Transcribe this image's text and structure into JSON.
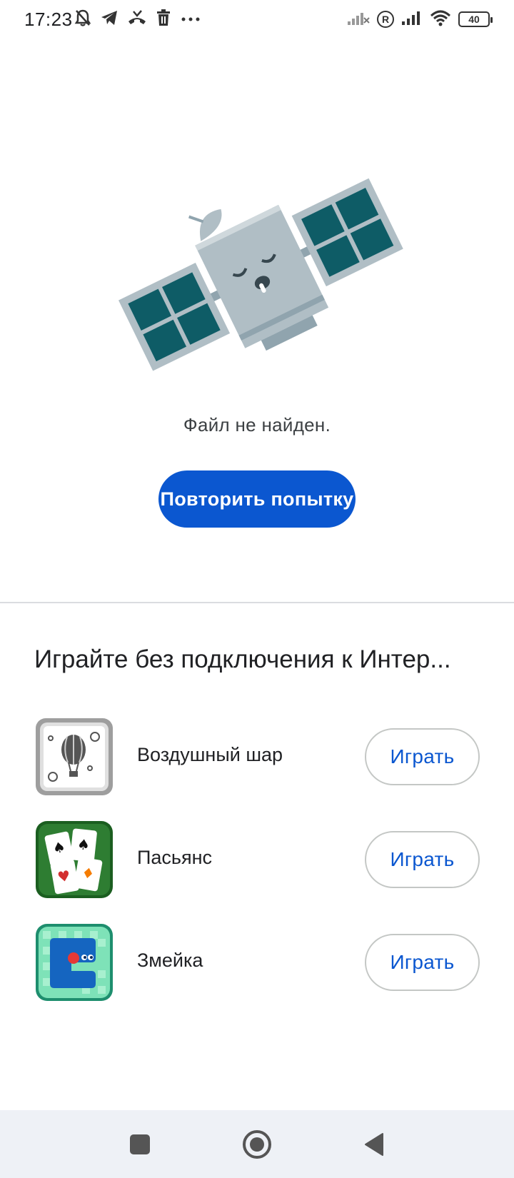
{
  "status_bar": {
    "time": "17:23",
    "left_icons": [
      "bell-off-icon",
      "telegram-icon",
      "missed-call-icon",
      "trash-icon",
      "more-dots-icon"
    ],
    "right_icons": [
      "signal-off-icon",
      "roaming-r-icon",
      "signal-icon",
      "wifi-icon",
      "battery-icon"
    ],
    "roaming_label": "R",
    "battery_level": "40"
  },
  "error": {
    "illustration": "sleeping-satellite",
    "message": "Файл не найден.",
    "retry_label": "Повторить попытку"
  },
  "games": {
    "title": "Играйте без подключения к Интер...",
    "items": [
      {
        "name": "Воздушный шар",
        "icon": "balloon-game-icon",
        "play_label": "Играть"
      },
      {
        "name": "Пасьянс",
        "icon": "solitaire-game-icon",
        "play_label": "Играть"
      },
      {
        "name": "Змейка",
        "icon": "snake-game-icon",
        "play_label": "Играть"
      }
    ]
  },
  "nav_bar": {
    "buttons": [
      "recents-square-icon",
      "home-circle-icon",
      "back-triangle-icon"
    ]
  },
  "colors": {
    "accent": "#0b57d0",
    "satellite_panel": "#0e5c66",
    "satellite_body": "#b0bec5",
    "nav_bg": "#eef1f6"
  }
}
